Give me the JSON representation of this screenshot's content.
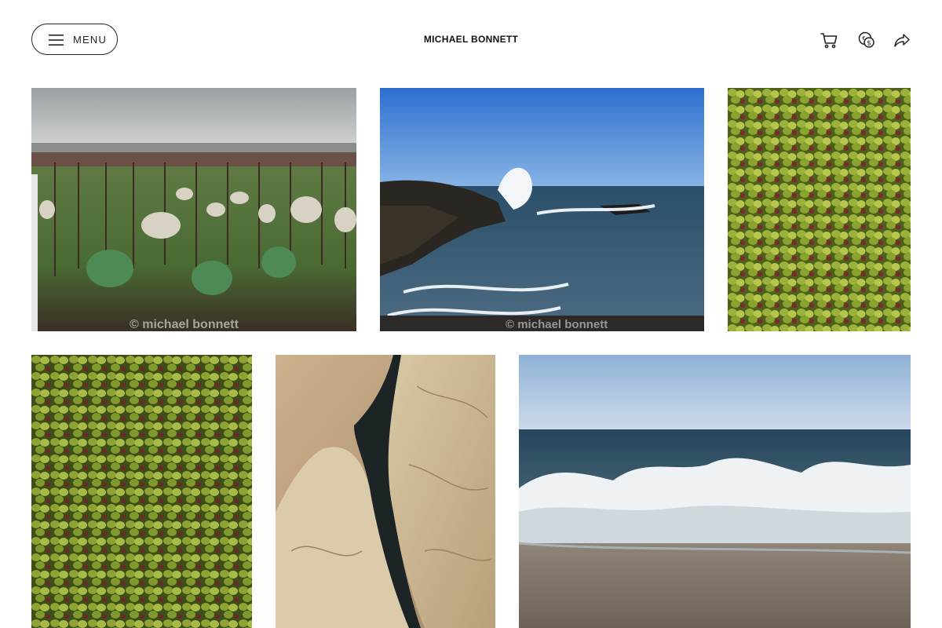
{
  "header": {
    "menu_label": "MENU",
    "site_title": "MICHAEL BONNETT",
    "icons": [
      "menu-icon",
      "cart-icon",
      "currency-icon",
      "share-icon"
    ]
  },
  "gallery": {
    "photos": [
      {
        "subject": "sheep grazing in vineyard",
        "watermark": "© michael bonnett"
      },
      {
        "subject": "waves crashing on rocky coast",
        "watermark": "© michael bonnett"
      },
      {
        "subject": "olives close-up"
      },
      {
        "subject": "olives close-up"
      },
      {
        "subject": "eroded sandstone rock channel"
      },
      {
        "subject": "surf breaking on beach"
      }
    ]
  },
  "colors": {
    "background": "#ffffff",
    "text": "#111111",
    "border": "#222222"
  }
}
